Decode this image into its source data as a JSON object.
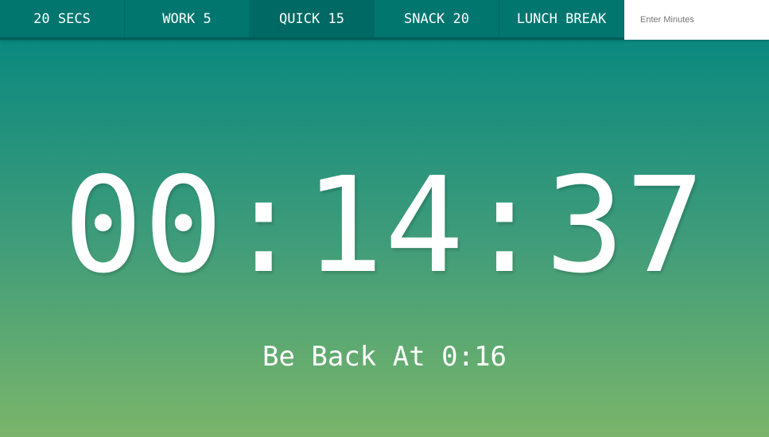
{
  "nav": {
    "buttons": [
      {
        "label": "20 SECS",
        "active": false
      },
      {
        "label": "WORK 5",
        "active": false
      },
      {
        "label": "QUICK 15",
        "active": true
      },
      {
        "label": "SNACK 20",
        "active": false
      },
      {
        "label": "LUNCH BREAK",
        "active": false
      }
    ],
    "minutes_placeholder": "Enter Minutes",
    "minutes_value": ""
  },
  "timer": {
    "display": "00:14:37"
  },
  "end_time": {
    "text": "Be Back At 0:16"
  },
  "colors": {
    "nav": "#00766f",
    "nav_active": "#006963",
    "gradient_top": "#008580",
    "gradient_bottom": "#7ab56a"
  }
}
